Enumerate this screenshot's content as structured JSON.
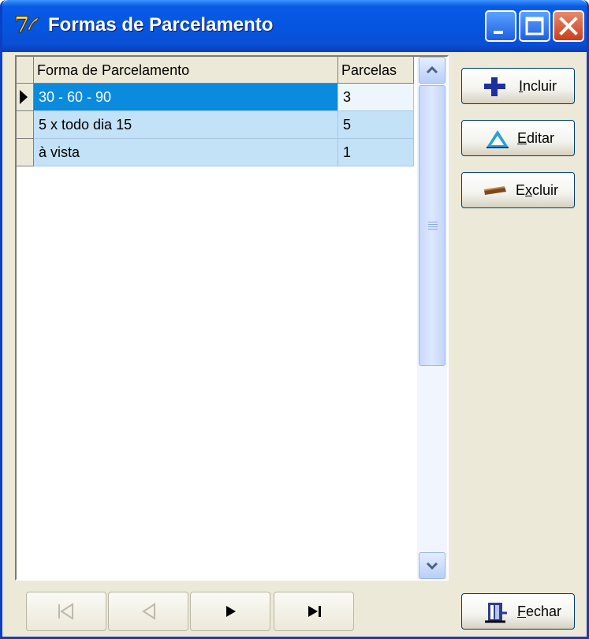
{
  "window": {
    "title": "Formas de Parcelamento",
    "controls": [
      "minimize-icon",
      "maximize-icon",
      "close-icon"
    ]
  },
  "grid": {
    "columns": [
      "Forma de Parcelamento",
      "Parcelas"
    ],
    "rows": [
      {
        "forma": "30 - 60 - 90",
        "parcelas": "3",
        "selected": true
      },
      {
        "forma": "5 x todo dia 15",
        "parcelas": "5",
        "selected": false
      },
      {
        "forma": "à vista",
        "parcelas": "1",
        "selected": false
      }
    ]
  },
  "actions": {
    "incluir": {
      "underline": "I",
      "rest": "ncluir",
      "icon": "plus-icon"
    },
    "editar": {
      "underline": "E",
      "rest": "ditar",
      "icon": "triangle-icon"
    },
    "excluir": {
      "prefix": "E",
      "underline": "x",
      "rest": "cluir",
      "icon": "minus-icon"
    },
    "fechar": {
      "underline": "F",
      "rest": "echar",
      "icon": "door-icon"
    }
  },
  "navigator": [
    "first-record-icon",
    "prior-record-icon",
    "next-record-icon",
    "last-record-icon"
  ],
  "colors": {
    "titlebar": "#0655E0",
    "selected_cell": "#0A8BDE",
    "row_background": "#C3E1F7",
    "window_background": "#ECE9D8"
  }
}
